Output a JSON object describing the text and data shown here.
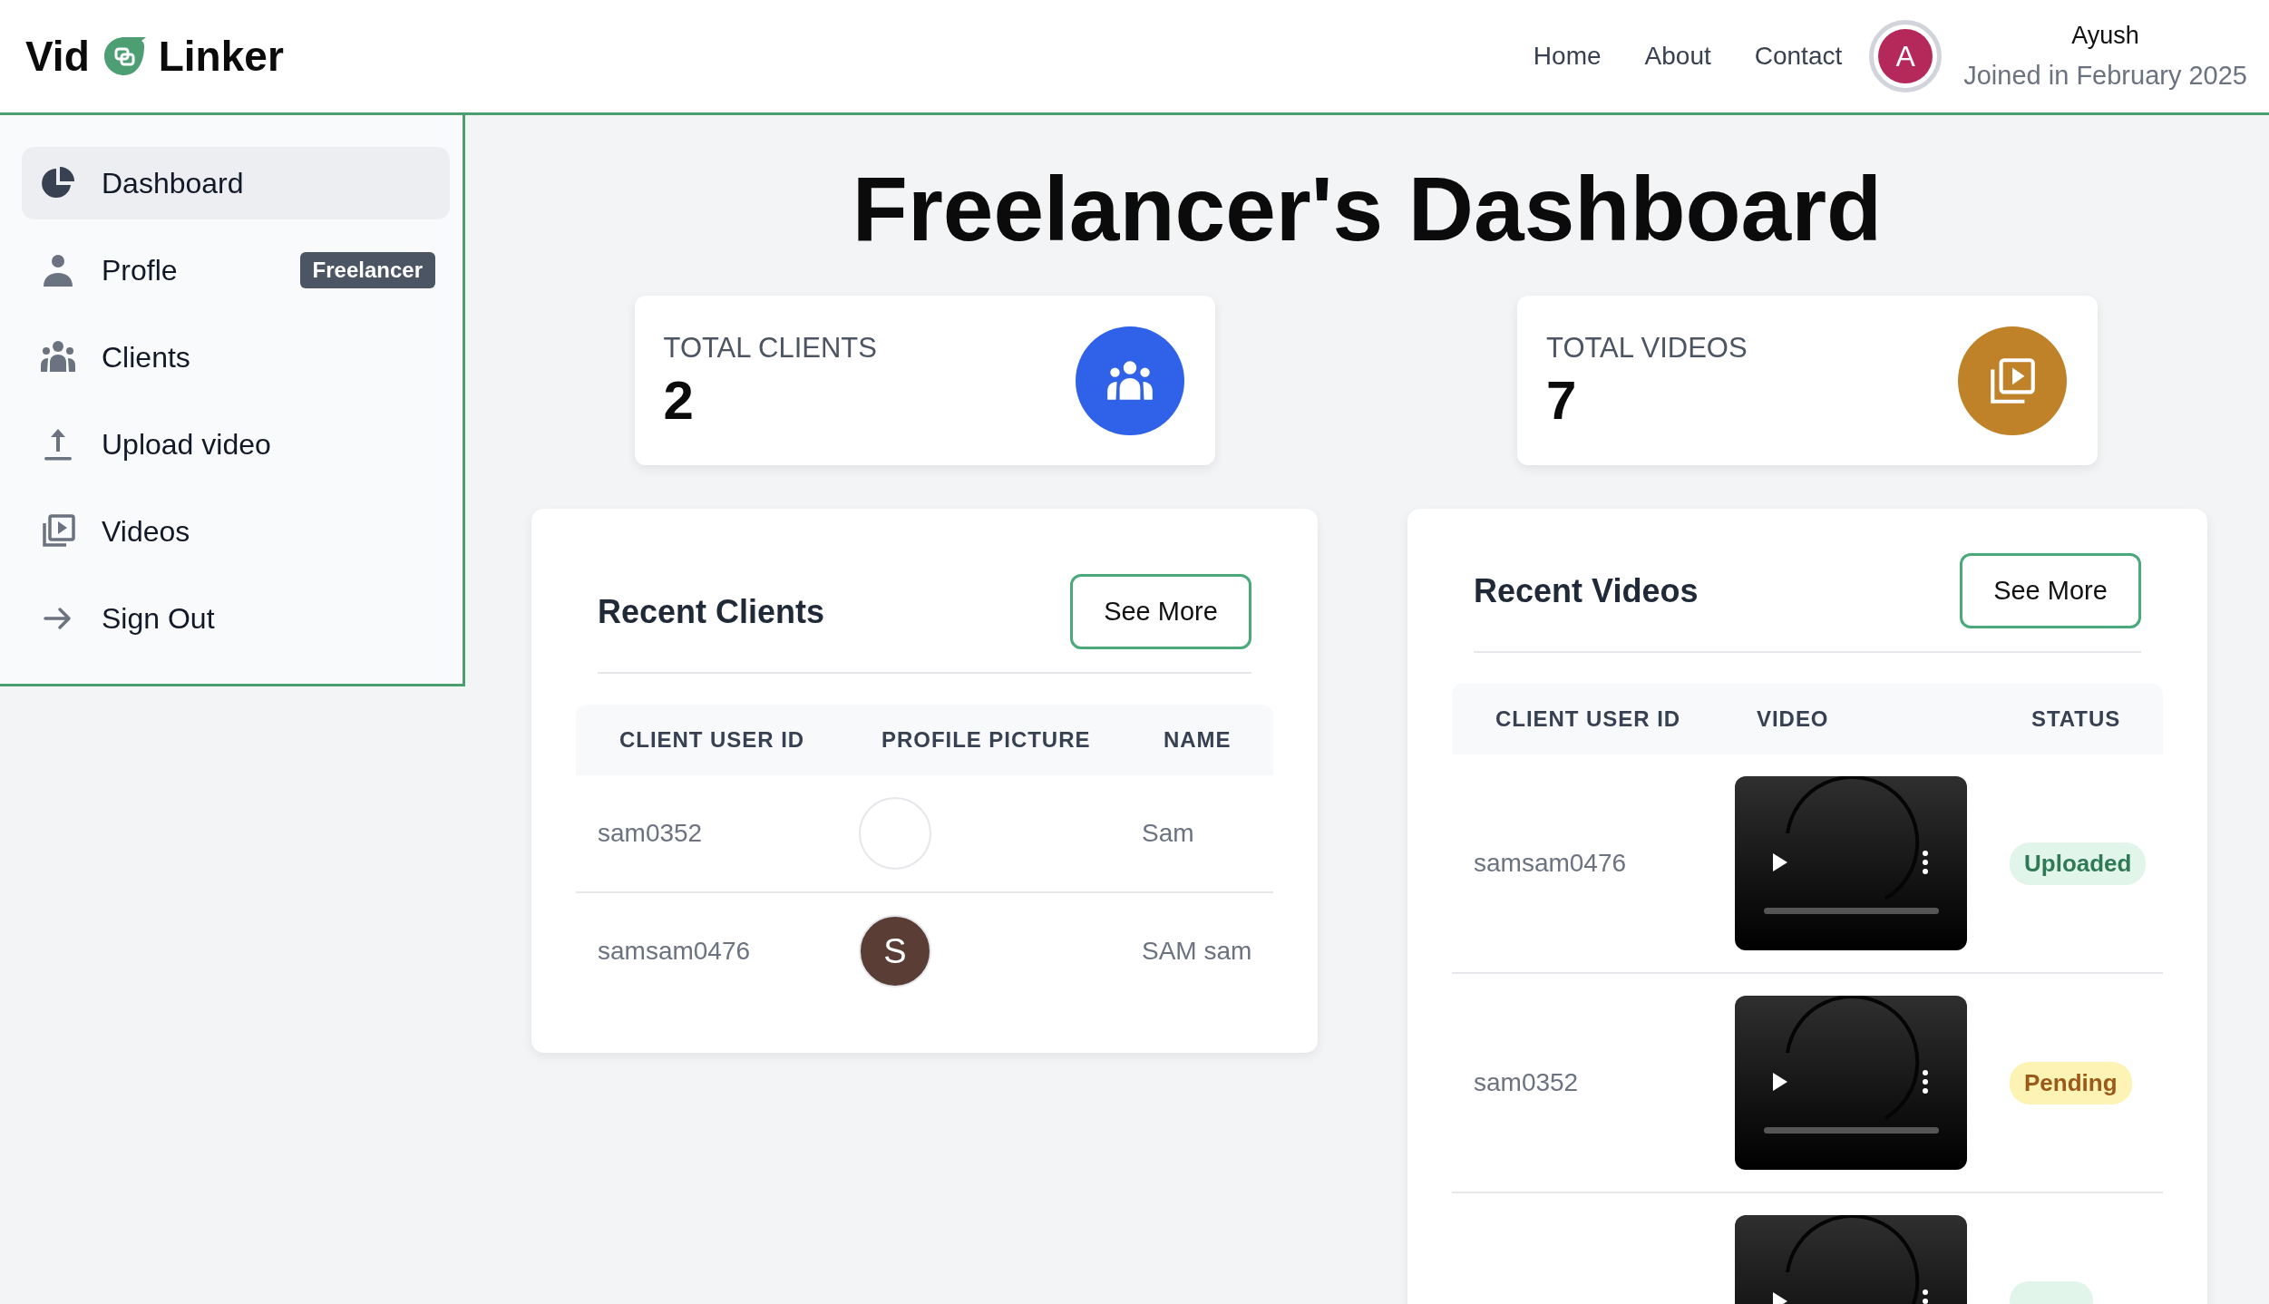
{
  "brand": {
    "left": "Vid",
    "right": "Linker"
  },
  "nav": [
    "Home",
    "About",
    "Contact"
  ],
  "user": {
    "initial": "A",
    "color": "#b5295a",
    "name": "Ayush",
    "joined": "Joined in February 2025"
  },
  "sidebar": {
    "items": [
      {
        "label": "Dashboard",
        "selected": true
      },
      {
        "label": "Profle",
        "selected": false,
        "badge": "Freelancer"
      },
      {
        "label": "Clients",
        "selected": false
      },
      {
        "label": "Upload video",
        "selected": false
      },
      {
        "label": "Videos",
        "selected": false
      },
      {
        "label": "Sign Out",
        "selected": false
      }
    ]
  },
  "title": "Freelancer's Dashboard",
  "stats": [
    {
      "label": "TOTAL CLIENTS",
      "value": "2",
      "color": "#2f62e9"
    },
    {
      "label": "TOTAL VIDEOS",
      "value": "7",
      "color": "#c08228"
    }
  ],
  "recent_clients": {
    "title": "Recent Clients",
    "button": "See More",
    "columns": [
      "CLIENT USER ID",
      "PROFILE PICTURE",
      "NAME"
    ],
    "rows": [
      {
        "client_user_id": "sam0352",
        "name": "Sam"
      },
      {
        "client_user_id": "samsam0476",
        "avatar": {
          "initial": "S",
          "color": "#5a3e36"
        },
        "name": "SAM sam"
      }
    ]
  },
  "recent_videos": {
    "title": "Recent Videos",
    "button": "See More",
    "columns": [
      "CLIENT USER ID",
      "VIDEO",
      "STATUS"
    ],
    "rows": [
      {
        "client_user_id": "samsam0476",
        "status": {
          "kind": "uploaded",
          "label": "Uploaded"
        }
      },
      {
        "client_user_id": "sam0352",
        "status": {
          "kind": "pending",
          "label": "Pending"
        }
      },
      {
        "status": {
          "kind": "uploaded"
        }
      }
    ]
  }
}
